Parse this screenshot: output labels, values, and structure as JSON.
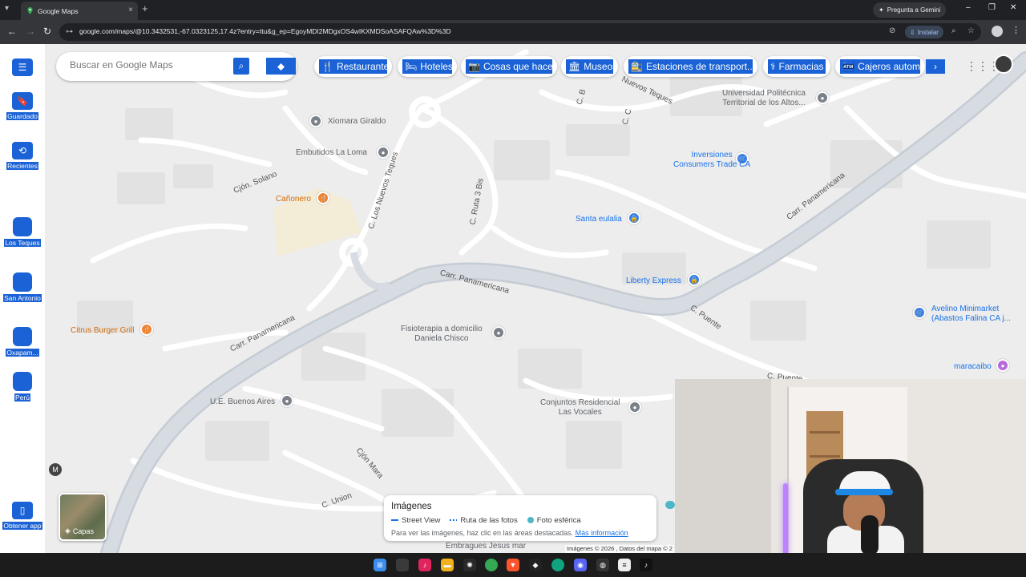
{
  "browser": {
    "tab_title": "Google Maps",
    "tab_close": "×",
    "new_tab": "+",
    "gemini_label": "Pregunta a Gemini",
    "url": "google.com/maps/@10.3432531,-67.0323125,17.4z?entry=ttu&g_ep=EgoyMDI2MDgxOS4wIKXMDSoASAFQAw%3D%3D",
    "install_label": "Instalar"
  },
  "sidebar": {
    "items": [
      {
        "label": "Guardado",
        "icon": "bookmark-icon"
      },
      {
        "label": "Recientes",
        "icon": "history-icon"
      },
      {
        "label": "Los Teques",
        "icon": "place-thumb"
      },
      {
        "label": "San Antonio",
        "icon": "place-thumb"
      },
      {
        "label": "Oxapam...",
        "icon": "place-thumb"
      },
      {
        "label": "Perú",
        "icon": "place-thumb"
      },
      {
        "label": "Obtener app",
        "icon": "phone-icon"
      }
    ]
  },
  "search": {
    "placeholder": "Buscar en Google Maps"
  },
  "chips": [
    {
      "label": "Restaurantes",
      "icon": "🍴"
    },
    {
      "label": "Hoteles",
      "icon": "🛏"
    },
    {
      "label": "Cosas que hacer",
      "icon": "📷"
    },
    {
      "label": "Museos",
      "icon": "🏛"
    },
    {
      "label": "Estaciones de transport...",
      "icon": "🚉"
    },
    {
      "label": "Farmacias",
      "icon": "⚕"
    },
    {
      "label": "Cajeros automát",
      "icon": "🏧"
    }
  ],
  "map": {
    "places": [
      {
        "name": "Xiomara Giraldo"
      },
      {
        "name": "Embutidos La Loma"
      },
      {
        "name": "Cañonero"
      },
      {
        "name": "Universidad Politécnica\nTerritorial de los Altos..."
      },
      {
        "name": "Inversiones\nConsumers Trade CA"
      },
      {
        "name": "Santa eulalia"
      },
      {
        "name": "Liberty Express"
      },
      {
        "name": "Avelino Minimarket\n(Abastos Falina CA j..."
      },
      {
        "name": "maracaibo"
      },
      {
        "name": "Citrus Burger Grill"
      },
      {
        "name": "Fisioterapia a domicilio\nDaniela Chisco"
      },
      {
        "name": "U.E. Buenos Aires"
      },
      {
        "name": "Conjuntos Residencial\nLas Vocales"
      },
      {
        "name": "Embragues Jesus mar"
      }
    ],
    "roads": [
      {
        "name": "Carr. Panamericana"
      },
      {
        "name": "Carr. Panamericana"
      },
      {
        "name": "Carr. Panamericana"
      },
      {
        "name": "C. Los Nuevos Teques"
      },
      {
        "name": "C. Ruta 3 Bis"
      },
      {
        "name": "Cjón. Solano"
      },
      {
        "name": "C. Puente"
      },
      {
        "name": "C. Union"
      },
      {
        "name": "Cjón Mara"
      },
      {
        "name": "C. Puente"
      },
      {
        "name": "Nuevos Teques"
      },
      {
        "name": "C. B"
      },
      {
        "name": "C. C"
      }
    ],
    "layers_label": "Capas",
    "metro_label": "M"
  },
  "images_panel": {
    "title": "Imágenes",
    "legend": [
      "Street View",
      "Ruta de las fotos",
      "Foto esférica"
    ],
    "hint": "Para ver las imágenes, haz clic en las áreas destacadas.",
    "link": "Más información"
  },
  "attribution": "Imágenes © 2026 , Datos del mapa © 2"
}
